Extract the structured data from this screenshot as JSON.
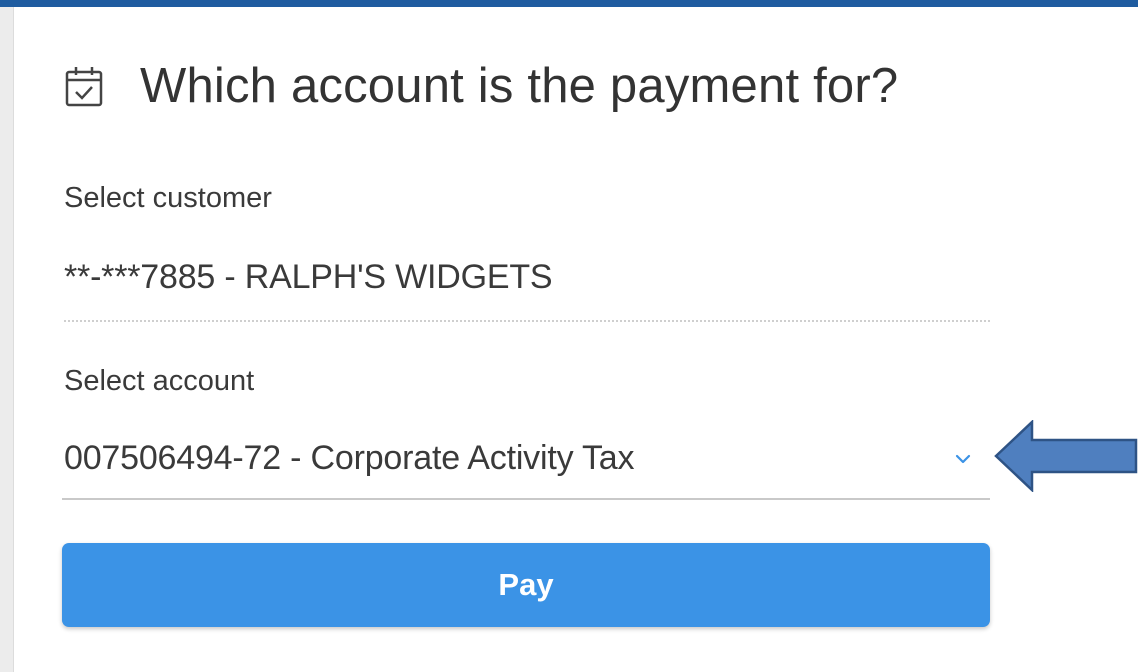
{
  "heading": {
    "icon": "calendar-check-icon",
    "title": "Which account is the payment for?"
  },
  "customer": {
    "label": "Select customer",
    "value": "**-***7885 - RALPH'S WIDGETS"
  },
  "account": {
    "label": "Select account",
    "selected": "007506494-72 - Corporate Activity Tax",
    "dropdown_icon": "chevron-down-icon"
  },
  "actions": {
    "pay_label": "Pay"
  },
  "annotation": {
    "icon": "arrow-left-icon"
  },
  "colors": {
    "top_bar": "#1f5ca0",
    "button": "#3b93e6",
    "chevron": "#3b93e6",
    "arrow_fill": "#4f7fbf",
    "arrow_stroke": "#2e5385",
    "text": "#333333"
  }
}
